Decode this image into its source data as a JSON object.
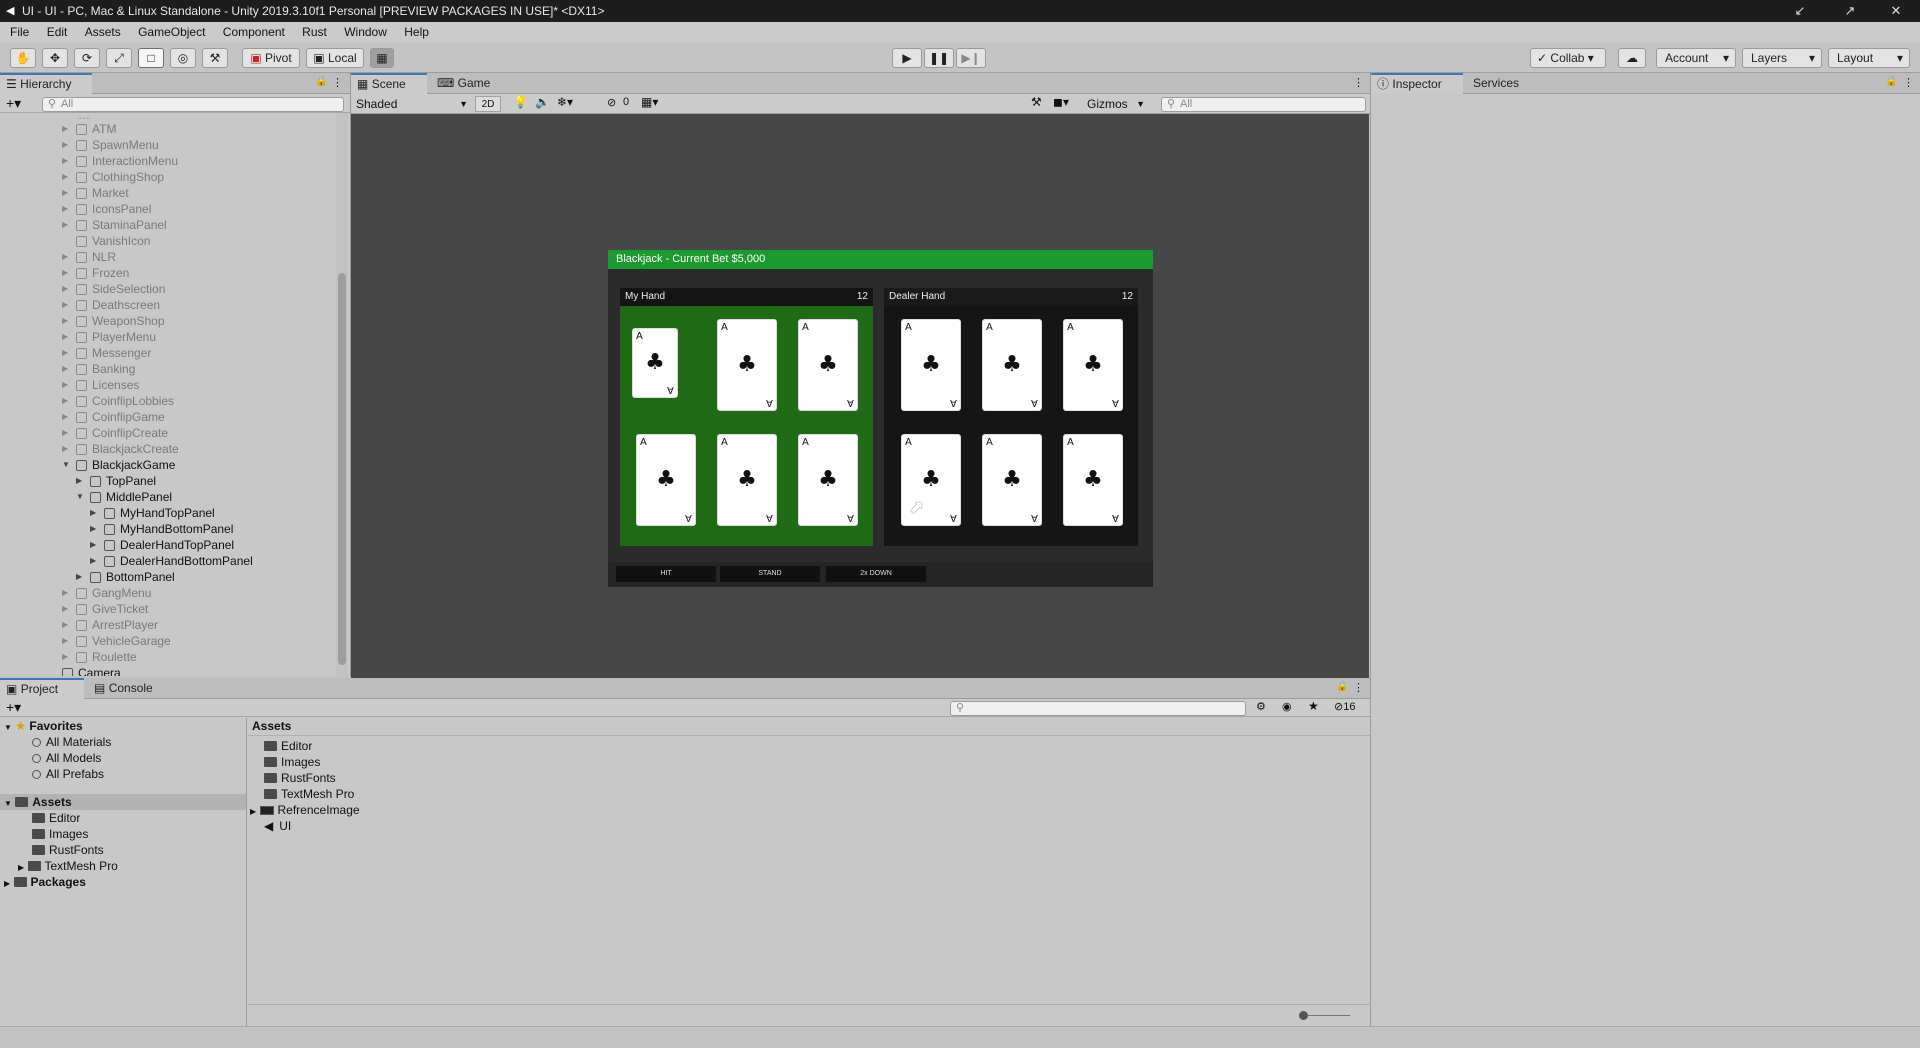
{
  "window": {
    "title": "UI - UI - PC, Mac & Linux Standalone - Unity 2019.3.10f1 Personal [PREVIEW PACKAGES IN USE]* <DX11>",
    "controls": [
      "↙",
      "↗",
      "✕"
    ]
  },
  "menu": [
    "File",
    "Edit",
    "Assets",
    "GameObject",
    "Component",
    "Rust",
    "Window",
    "Help"
  ],
  "toolbar": {
    "pivot_label": "Pivot",
    "local_label": "Local",
    "collab_label": "Collab",
    "account_label": "Account",
    "layers_label": "Layers",
    "layout_label": "Layout"
  },
  "hierarchy": {
    "tab_label": "Hierarchy",
    "search_placeholder": "All",
    "items": [
      {
        "label": "ATM",
        "dim": true,
        "expandable": true
      },
      {
        "label": "SpawnMenu",
        "dim": true,
        "expandable": true
      },
      {
        "label": "InteractionMenu",
        "dim": true,
        "expandable": true
      },
      {
        "label": "ClothingShop",
        "dim": true,
        "expandable": true
      },
      {
        "label": "Market",
        "dim": true,
        "expandable": true
      },
      {
        "label": "IconsPanel",
        "dim": true,
        "expandable": true
      },
      {
        "label": "StaminaPanel",
        "dim": true,
        "expandable": true
      },
      {
        "label": "VanishIcon",
        "dim": true,
        "expandable": false
      },
      {
        "label": "NLR",
        "dim": true,
        "expandable": true
      },
      {
        "label": "Frozen",
        "dim": true,
        "expandable": true
      },
      {
        "label": "SideSelection",
        "dim": true,
        "expandable": true
      },
      {
        "label": "Deathscreen",
        "dim": true,
        "expandable": true
      },
      {
        "label": "WeaponShop",
        "dim": true,
        "expandable": true
      },
      {
        "label": "PlayerMenu",
        "dim": true,
        "expandable": true
      },
      {
        "label": "Messenger",
        "dim": true,
        "expandable": true
      },
      {
        "label": "Banking",
        "dim": true,
        "expandable": true
      },
      {
        "label": "Licenses",
        "dim": true,
        "expandable": true
      },
      {
        "label": "CoinflipLobbies",
        "dim": true,
        "expandable": true
      },
      {
        "label": "CoinflipGame",
        "dim": true,
        "expandable": true
      },
      {
        "label": "CoinflipCreate",
        "dim": true,
        "expandable": true
      },
      {
        "label": "BlackjackCreate",
        "dim": true,
        "expandable": true
      },
      {
        "label": "BlackjackGame",
        "dim": false,
        "expandable": true,
        "expanded": true
      },
      {
        "label": "TopPanel",
        "dim": false,
        "expandable": true,
        "indent": 1
      },
      {
        "label": "MiddlePanel",
        "dim": false,
        "expandable": true,
        "expanded": true,
        "indent": 1
      },
      {
        "label": "MyHandTopPanel",
        "dim": false,
        "expandable": true,
        "indent": 2
      },
      {
        "label": "MyHandBottomPanel",
        "dim": false,
        "expandable": true,
        "indent": 2
      },
      {
        "label": "DealerHandTopPanel",
        "dim": false,
        "expandable": true,
        "indent": 2
      },
      {
        "label": "DealerHandBottomPanel",
        "dim": false,
        "expandable": true,
        "indent": 2
      },
      {
        "label": "BottomPanel",
        "dim": false,
        "expandable": true,
        "indent": 1
      },
      {
        "label": "GangMenu",
        "dim": true,
        "expandable": true
      },
      {
        "label": "GiveTicket",
        "dim": true,
        "expandable": true
      },
      {
        "label": "ArrestPlayer",
        "dim": true,
        "expandable": true
      },
      {
        "label": "VehicleGarage",
        "dim": true,
        "expandable": true
      },
      {
        "label": "Roulette",
        "dim": true,
        "expandable": true
      },
      {
        "label": "Camera",
        "dim": false,
        "expandable": false,
        "indent": -1
      }
    ]
  },
  "scene": {
    "tabs": [
      "Scene",
      "Game"
    ],
    "shading_mode": "Shaded",
    "toggle_2d": "2D",
    "hidden_count": "0",
    "gizmos_label": "Gizmos",
    "search_placeholder": "All"
  },
  "blackjack": {
    "header": "Blackjack - Current Bet $5,000",
    "my_hand_title": "My Hand",
    "my_hand_score": "12",
    "dealer_hand_title": "Dealer Hand",
    "dealer_hand_score": "12",
    "card_rank": "A",
    "card_suit": "♣",
    "buttons": [
      "HIT",
      "STAND",
      "2x DOWN"
    ],
    "colors": {
      "header": "#1b9a2e",
      "my_hand_bg": "#1f6b15",
      "dealer_bg": "#151515"
    }
  },
  "inspector": {
    "tabs": [
      "Inspector",
      "Services"
    ]
  },
  "project": {
    "tabs": [
      "Project",
      "Console"
    ],
    "favorites_label": "Favorites",
    "favorites": [
      "All Materials",
      "All Models",
      "All Prefabs"
    ],
    "assets_label": "Assets",
    "asset_folders": [
      "Editor",
      "Images",
      "RustFonts",
      "TextMesh Pro"
    ],
    "packages_label": "Packages",
    "breadcrumb": "Assets",
    "grid_items": [
      "Editor",
      "Images",
      "RustFonts",
      "TextMesh Pro",
      "RefrenceImage",
      "UI"
    ],
    "hidden_count": "16"
  }
}
